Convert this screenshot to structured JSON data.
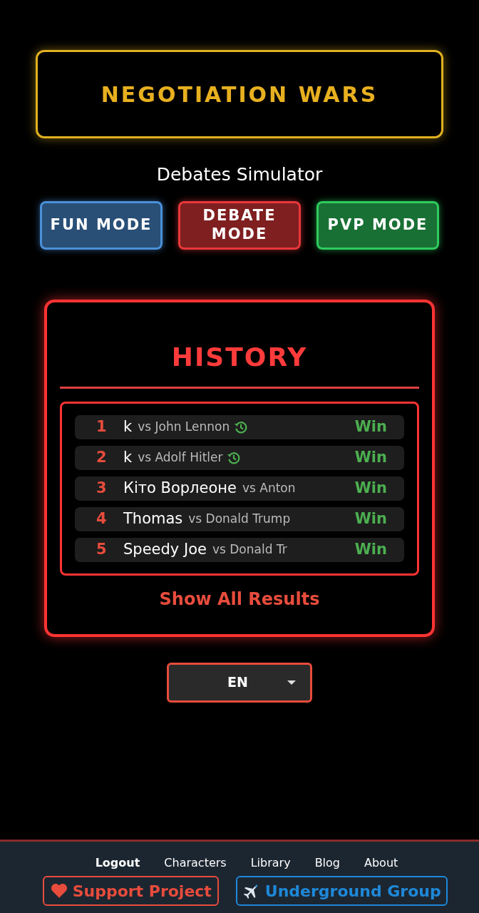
{
  "header": {
    "title": "NEGOTIATION WARS",
    "subtitle": "Debates Simulator"
  },
  "modes": [
    {
      "label": "FUN MODE",
      "color": "#4a90d9"
    },
    {
      "label": "DEBATE MODE",
      "color": "#e8383b"
    },
    {
      "label": "PVP MODE",
      "color": "#2ecc5e"
    }
  ],
  "history": {
    "title": "HISTORY",
    "rows": [
      {
        "rank": "1",
        "player": "k",
        "opponent": "vs John Lennon",
        "replay": true,
        "result": "Win"
      },
      {
        "rank": "2",
        "player": "k",
        "opponent": "vs Adolf Hitler",
        "replay": true,
        "result": "Win"
      },
      {
        "rank": "3",
        "player": "Кіто Ворлеоне",
        "opponent": "vs Anton",
        "replay": false,
        "result": "Win"
      },
      {
        "rank": "4",
        "player": "Thomas",
        "opponent": "vs Donald Trump",
        "replay": false,
        "result": "Win"
      },
      {
        "rank": "5",
        "player": "Speedy Joe",
        "opponent": "vs Donald Tr",
        "replay": false,
        "result": "Win"
      }
    ],
    "show_all": "Show All Results"
  },
  "language": "EN",
  "footer": {
    "links": [
      {
        "label": "Logout",
        "bold": true
      },
      {
        "label": "Characters",
        "bold": false
      },
      {
        "label": "Library",
        "bold": false
      },
      {
        "label": "Blog",
        "bold": false
      },
      {
        "label": "About",
        "bold": false
      }
    ],
    "buttons": [
      {
        "kind": "support",
        "label": "Support Project"
      },
      {
        "kind": "group",
        "label": "Underground Group"
      }
    ]
  }
}
